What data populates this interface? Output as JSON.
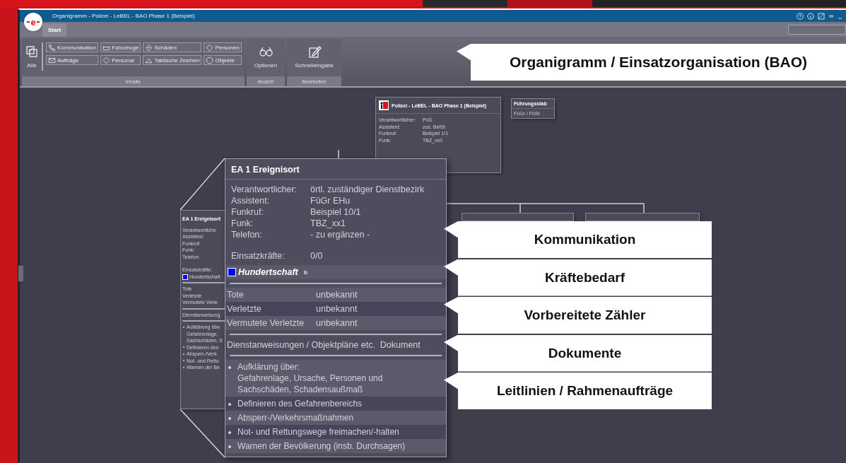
{
  "window": {
    "title": "Organigramm - Polizei - LeBEL - BAO Phase 1 (Beispiel)",
    "logo": "e"
  },
  "tabs": [
    {
      "label": "Start",
      "selected": true
    }
  ],
  "ribbon": {
    "groups": [
      {
        "label": "Inhalte",
        "big": {
          "label": "Alle"
        },
        "buttons": [
          {
            "label": "Kommunikation"
          },
          {
            "label": "Aufträge"
          },
          {
            "label": "Fahrzeuge"
          },
          {
            "label": "Personal"
          },
          {
            "label": "Schäden"
          },
          {
            "label": "Taktische Zeichen"
          },
          {
            "label": "Personen"
          },
          {
            "label": "Objekte"
          }
        ]
      },
      {
        "label": "Ansicht",
        "big": {
          "label": "Optionen"
        }
      },
      {
        "label": "Bearbeiten",
        "big": {
          "label": "Schnelleingabe"
        }
      }
    ]
  },
  "root_node": {
    "title": "Polizei - LeBEL - BAO Phase 1 (Beispiel)",
    "fields": [
      {
        "label": "Verantwortlicher:",
        "value": "PvD"
      },
      {
        "label": "Assistent:",
        "value": "zus. BefSt"
      },
      {
        "label": "Funkruf:",
        "value": "Beispiel 1/1"
      },
      {
        "label": "Funk:",
        "value": "TBZ_xx0"
      }
    ]
  },
  "staff_node": {
    "title": "Führungsstab",
    "subtitle": "FüGr / FüSt"
  },
  "small_node": {
    "title": "EA 1 Ereignisort",
    "fields": [
      "Verantwortliche",
      "Assistent:",
      "Funkruf:",
      "Funk:",
      "Telefon:"
    ],
    "count_label": "Einsatzkräfte:",
    "unit": {
      "name": "Hundertschaft",
      "color": "#0000ff"
    },
    "counters": [
      "Tote",
      "Verletzte",
      "Vermutete Verle"
    ],
    "document": "Dienstanweisung",
    "tasks": [
      [
        "Aufklärung übe",
        "Gefahrenlage,",
        "Sachschäden, S"
      ],
      [
        "Definieren des"
      ],
      [
        "Absperr-/Verk"
      ],
      [
        "Not- und Rettu"
      ],
      [
        "Warnen der Be"
      ]
    ]
  },
  "popup": {
    "title": "EA 1 Ereignisort",
    "fields": [
      {
        "label": "Verantwortlicher:",
        "value": "örtl. zuständiger Dienstbezirk"
      },
      {
        "label": "Assistent:",
        "value": "FüGr EHu"
      },
      {
        "label": "Funkruf:",
        "value": "Beispiel 10/1"
      },
      {
        "label": "Funk:",
        "value": "TBZ_xx1"
      },
      {
        "label": "Telefon:",
        "value": "- zu ergänzen -"
      }
    ],
    "count": {
      "label": "Einsatzkräfte:",
      "value": "0/0"
    },
    "unit": {
      "name": "Hundertschaft",
      "suffix": "B",
      "color": "#0000ff"
    },
    "counters": [
      {
        "label": "Tote",
        "value": "unbekannt"
      },
      {
        "label": "Verletzte",
        "value": "unbekannt"
      },
      {
        "label": "Vermutete Verletzte",
        "value": "unbekannt"
      }
    ],
    "document": {
      "label": "Dienstanweisungen / Objektpläne etc.",
      "value": "Dokument"
    },
    "tasks": [
      [
        "Aufklärung über:",
        "Gefahrenlage, Ursache, Personen und",
        "Sachschäden, Schadensaußmaß"
      ],
      [
        "Definieren des Gefahrenbereichs"
      ],
      [
        "Absperr-/Verkehrsmaßnahmen"
      ],
      [
        "Not- und Rettungswege freimachen/-halten"
      ],
      [
        "Warnen der Bevölkerung (insb. Durchsagen)"
      ]
    ]
  },
  "main_callout": "Organigramm / Einsatzorganisation (BAO)",
  "callouts": [
    "Kommunikation",
    "Kräftebedarf",
    "Vorbereitete Zähler",
    "Dokumente",
    "Leitlinien / Rahmenaufträge"
  ]
}
